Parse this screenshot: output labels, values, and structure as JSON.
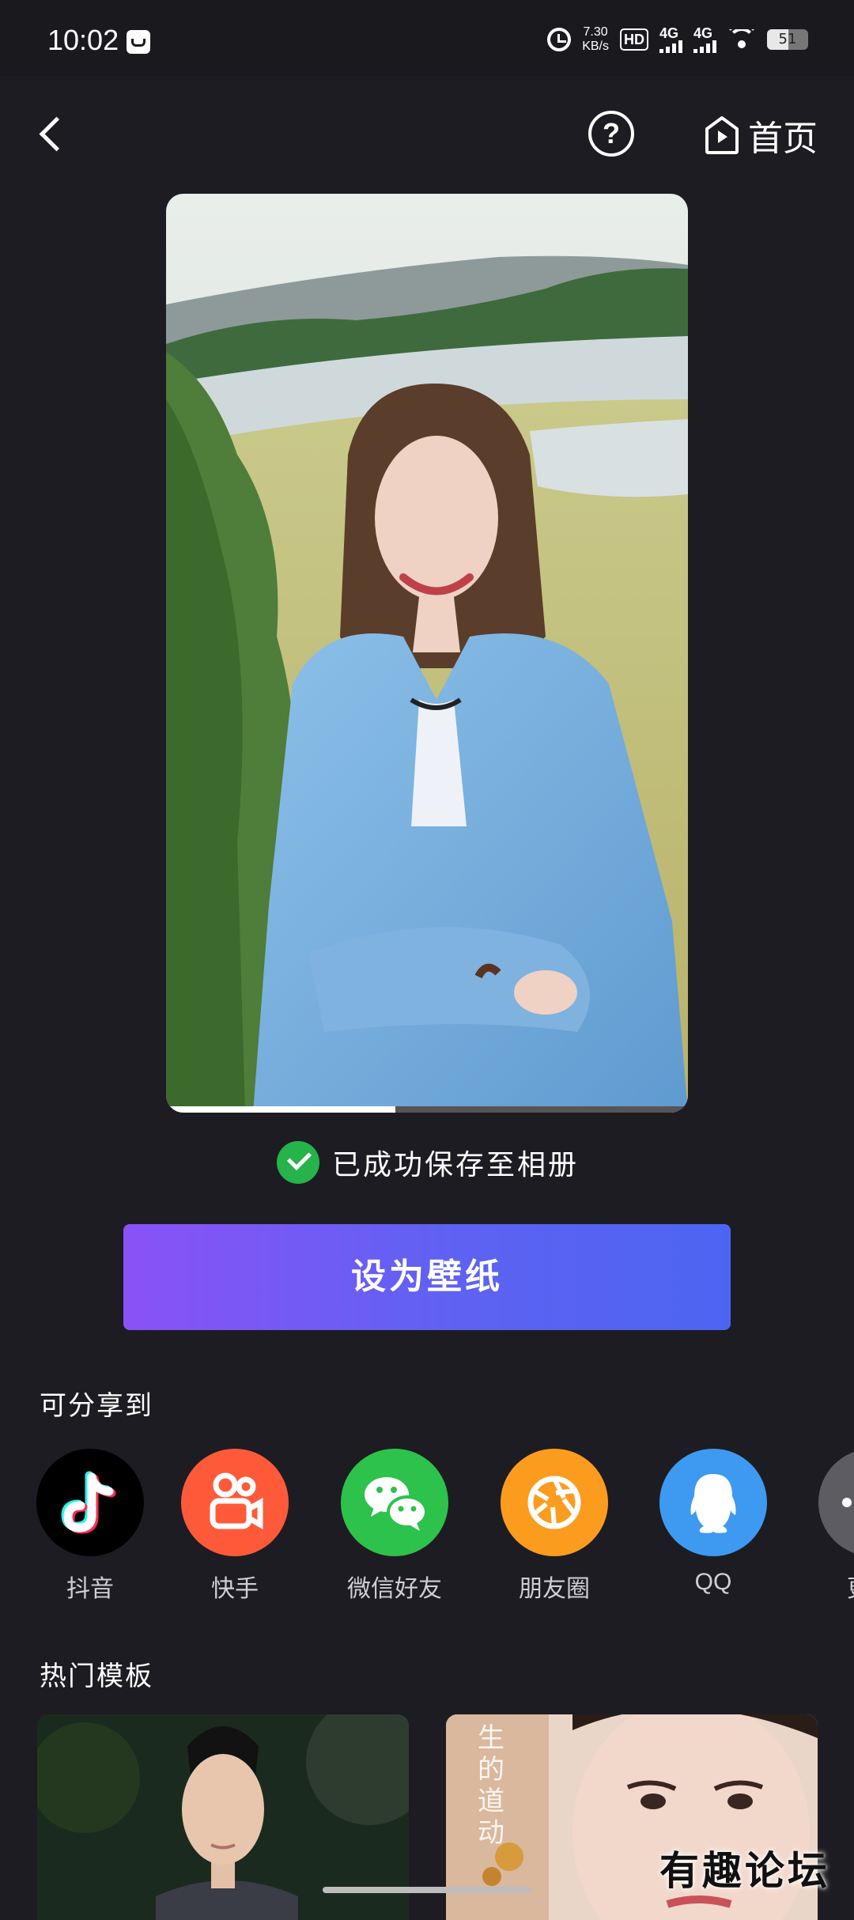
{
  "status_bar": {
    "time": "10:02",
    "net_speed_value": "7.30",
    "net_speed_unit": "KB/s",
    "hd_label": "HD",
    "sim1_label": "4G",
    "sim2_label": "4G",
    "battery": "51"
  },
  "header": {
    "help_label": "?",
    "home_label": "首页"
  },
  "preview": {
    "playback_progress": 0.44
  },
  "save_status": {
    "text": "已成功保存至相册"
  },
  "actions": {
    "set_wallpaper": "设为壁纸"
  },
  "share": {
    "title": "可分享到",
    "items": [
      {
        "label": "抖音",
        "icon": "douyin-icon",
        "color": "#000000"
      },
      {
        "label": "快手",
        "icon": "kuaishou-icon",
        "color": "#fe5a3a"
      },
      {
        "label": "微信好友",
        "icon": "wechat-icon",
        "color": "#2dc24b"
      },
      {
        "label": "朋友圈",
        "icon": "moments-icon",
        "color": "#fb9c1f"
      },
      {
        "label": "QQ",
        "icon": "qq-icon",
        "color": "#3d9af0"
      },
      {
        "label": "更",
        "icon": "more-icon",
        "color": "#5e5c63"
      }
    ]
  },
  "templates": {
    "title": "热门模板",
    "card_2_text": "生的道动"
  },
  "watermark": "有趣论坛",
  "colors": {
    "background": "#1d1c22",
    "accent_start": "#8a52f6",
    "accent_end": "#4d64f2",
    "success": "#26b34a"
  }
}
